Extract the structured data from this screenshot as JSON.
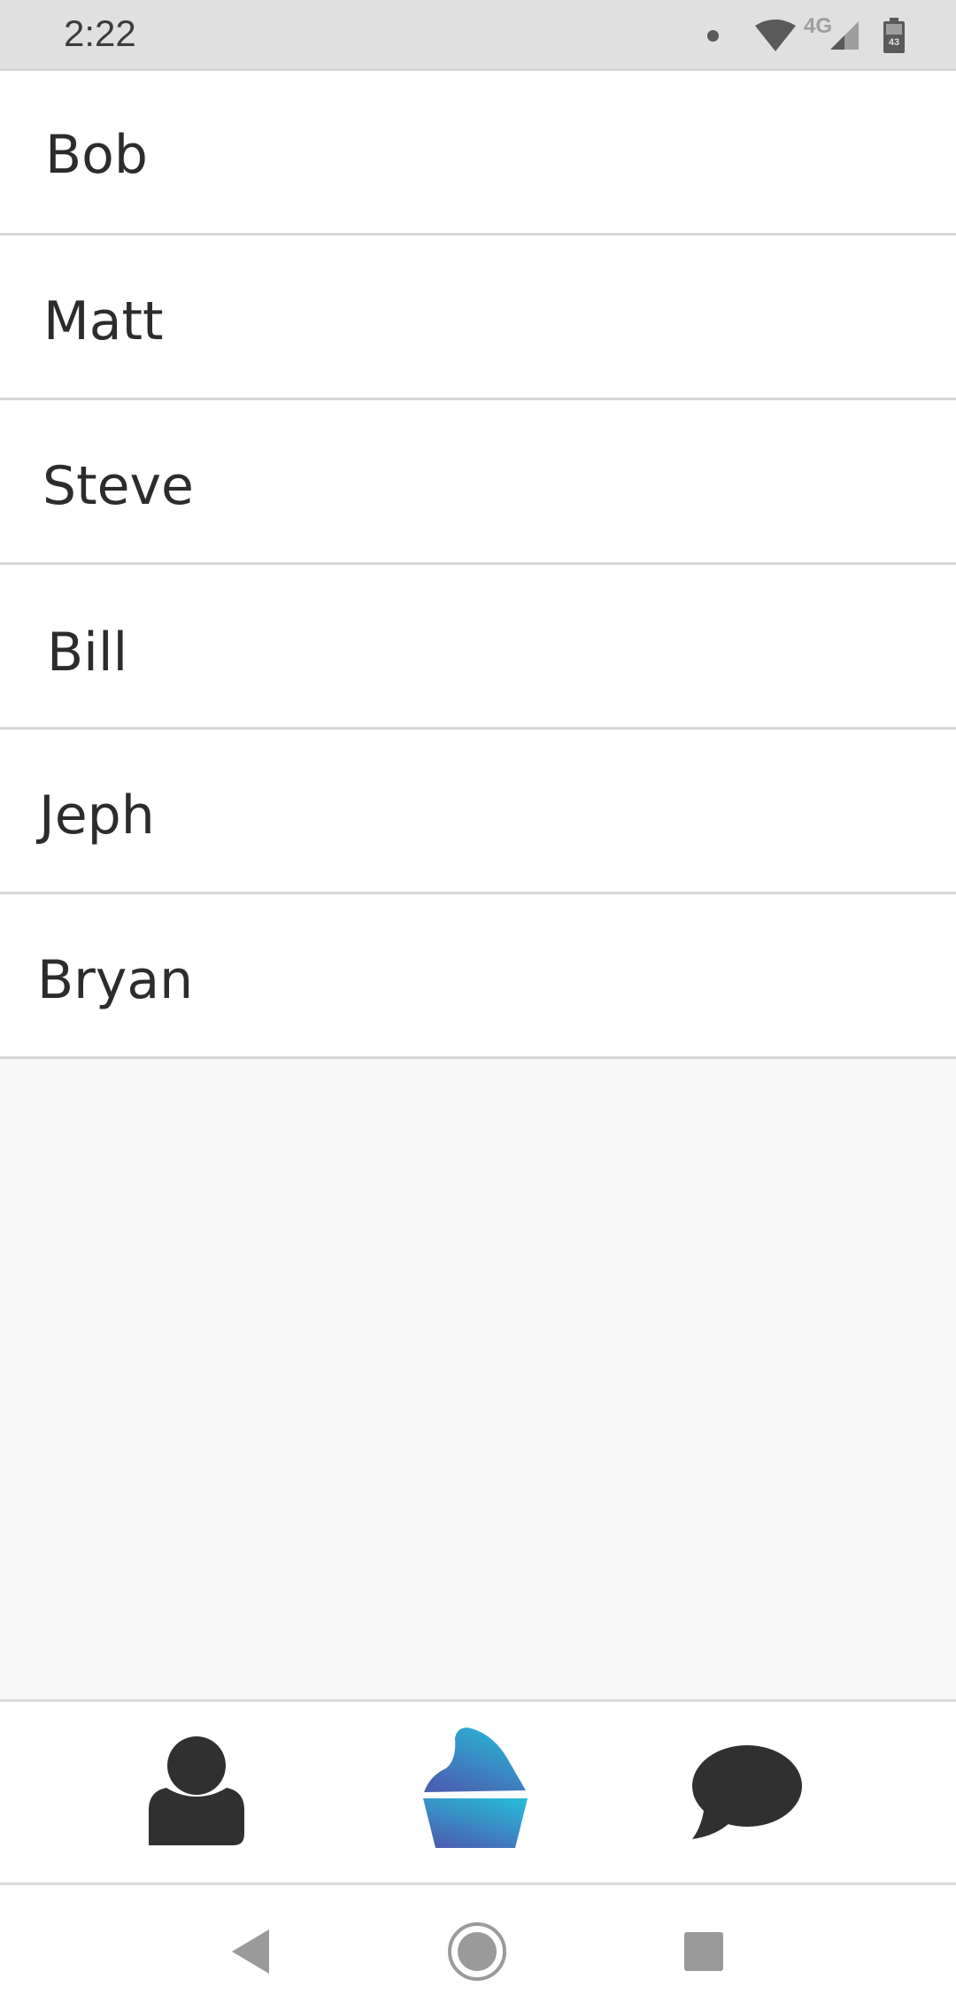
{
  "status_bar": {
    "time": "2:22",
    "network_type": "4G",
    "battery_level": "43",
    "icons": [
      "notification-dot-icon",
      "wifi-icon",
      "cell-signal-icon",
      "battery-icon"
    ]
  },
  "contacts": {
    "items": [
      {
        "name": "Bob"
      },
      {
        "name": "Matt"
      },
      {
        "name": "Steve"
      },
      {
        "name": "Bill"
      },
      {
        "name": "Jeph"
      },
      {
        "name": "Bryan"
      }
    ]
  },
  "tab_bar": {
    "tabs": [
      {
        "icon": "person-icon",
        "active": false
      },
      {
        "icon": "cupcake-icon",
        "active": true
      },
      {
        "icon": "chat-bubble-icon",
        "active": false
      }
    ],
    "active_gradient": [
      "#29b6d8",
      "#4a5fb0"
    ],
    "inactive_color": "#303030"
  },
  "nav_bar": {
    "icons": [
      "back-icon",
      "home-icon",
      "recents-icon"
    ]
  }
}
